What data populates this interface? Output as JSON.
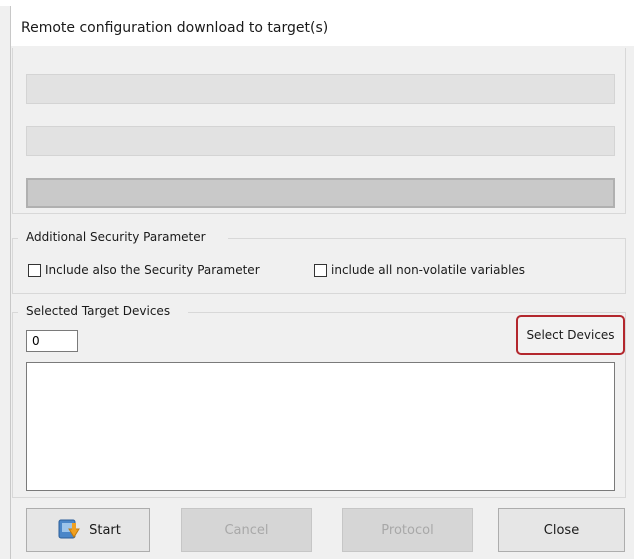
{
  "window": {
    "title": "Remote configuration download to target(s)"
  },
  "progress_bars": [
    {
      "value": 0
    },
    {
      "value": 0
    },
    {
      "value": 0
    }
  ],
  "security_group": {
    "label": "Additional Security Parameter",
    "include_security_label": "Include also the Security Parameter",
    "include_security_checked": false,
    "include_nonvolatile_label": "include all non-volatile variables",
    "include_nonvolatile_checked": false
  },
  "targets_group": {
    "label": "Selected Target Devices",
    "count_value": "0",
    "select_devices_label": "Select Devices",
    "devices": []
  },
  "buttons": {
    "start_label": "Start",
    "cancel_label": "Cancel",
    "protocol_label": "Protocol",
    "close_label": "Close"
  },
  "colors": {
    "highlight_border": "#b3272d",
    "dialog_bg": "#f0f0f0"
  },
  "icons": {
    "start": "start-download-icon"
  }
}
